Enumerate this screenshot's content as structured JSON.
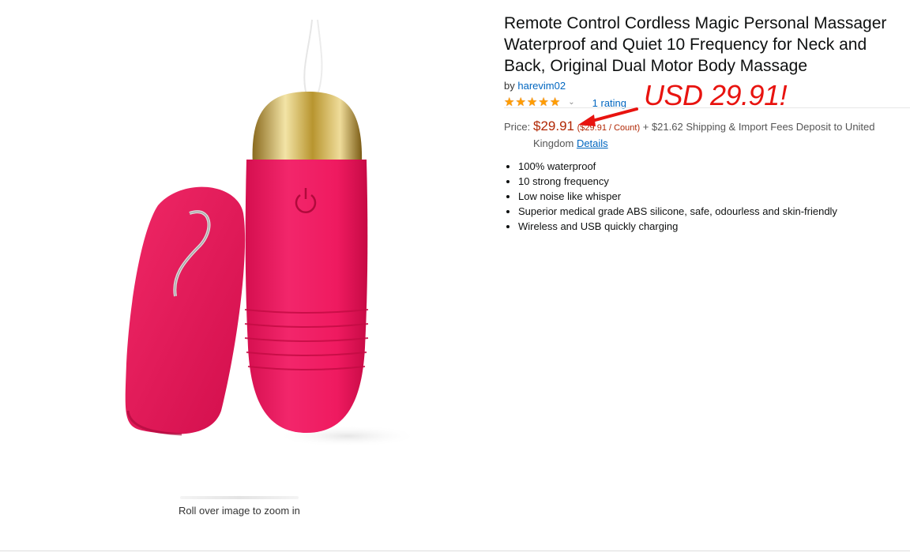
{
  "product": {
    "title": "Remote Control Cordless Magic Personal Massager Waterproof and Quiet 10 Frequency for Neck and Back, Original Dual Motor Body Massage",
    "by_prefix": "by",
    "brand": "harevim02",
    "rating_value": 5,
    "rating_count": "1 rating",
    "price_label": "Price:",
    "price": "$29.91",
    "price_per_unit": "($29.91 / Count)",
    "shipping": "+ $21.62 Shipping & Import Fees Deposit to United",
    "shipping_line2": "Kingdom",
    "details_link": "Details",
    "bullets": [
      "100% waterproof",
      "10 strong frequency",
      "Low noise like whisper",
      "Superior medical grade ABS silicone, safe, odourless and skin-friendly",
      "Wireless and USB quickly charging"
    ]
  },
  "image": {
    "zoom_hint": "Roll over image to zoom in"
  },
  "annotation": {
    "text": "USD 29.91!",
    "color": "#e8130f"
  },
  "colors": {
    "price": "#b12704",
    "link": "#0066c0",
    "star": "#ff9d00",
    "product_pink": "#f0195f",
    "cap_gold": "#c9a74a"
  },
  "icons": {
    "star": "star-icon",
    "chevron": "chevron-down-icon",
    "arrow": "red-arrow-annotation"
  }
}
